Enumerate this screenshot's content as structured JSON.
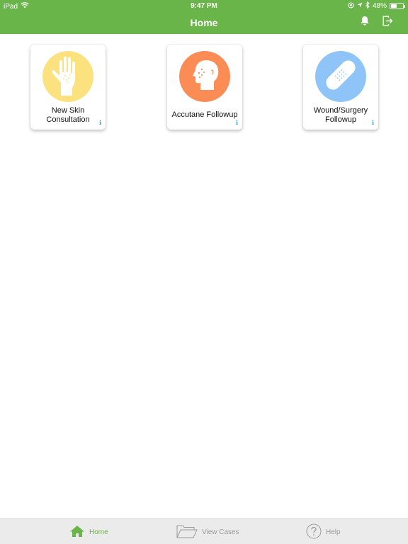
{
  "status_bar": {
    "device": "iPad",
    "time": "9:47 PM",
    "battery_percent": "48%",
    "battery_level": 0.48
  },
  "nav_bar": {
    "title": "Home",
    "bell_icon": "bell-icon",
    "logout_icon": "logout-icon"
  },
  "tiles": [
    {
      "label": "New Skin Consultation",
      "icon": "hand-icon",
      "color": "#fce27f"
    },
    {
      "label": "Accutane Followup",
      "icon": "face-profile-icon",
      "color": "#fb8c55"
    },
    {
      "label": "Wound/Surgery Followup",
      "icon": "bandage-icon",
      "color": "#8ec4f8"
    }
  ],
  "tile_info_glyph": "i",
  "tab_bar": {
    "items": [
      {
        "label": "Home",
        "icon": "home-icon",
        "active": true
      },
      {
        "label": "View Cases",
        "icon": "folder-icon",
        "active": false
      },
      {
        "label": "Help",
        "icon": "help-icon",
        "active": false
      }
    ]
  },
  "colors": {
    "brand_green": "#6ab54a",
    "tab_inactive": "#9a9a9a",
    "info_blue": "#2a9fd8"
  }
}
